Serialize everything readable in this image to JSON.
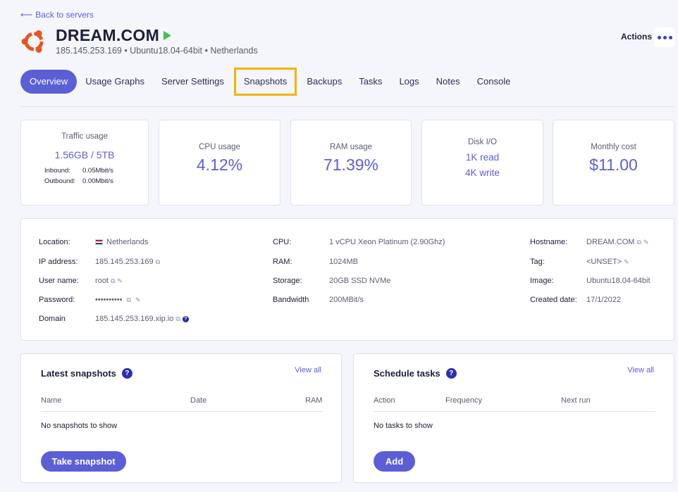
{
  "nav": {
    "back_label": "Back to servers"
  },
  "server": {
    "name": "DREAM.COM",
    "subtitle": "185.145.253.169 • Ubuntu18.04-64bit • Netherlands",
    "status_color": "#44c14b"
  },
  "header": {
    "actions_label": "Actions"
  },
  "tabs": [
    {
      "label": "Overview",
      "active": true
    },
    {
      "label": "Usage Graphs"
    },
    {
      "label": "Server Settings"
    },
    {
      "label": "Snapshots",
      "highlighted": true
    },
    {
      "label": "Backups"
    },
    {
      "label": "Tasks"
    },
    {
      "label": "Logs"
    },
    {
      "label": "Notes"
    },
    {
      "label": "Console"
    }
  ],
  "stats": {
    "traffic": {
      "label": "Traffic usage",
      "value": "1.56GB / 5TB",
      "inbound_label": "Inbound:",
      "inbound_value": "0.05Mbit/s",
      "outbound_label": "Outbound:",
      "outbound_value": "0.00Mbit/s"
    },
    "cpu": {
      "label": "CPU usage",
      "value": "4.12%"
    },
    "ram": {
      "label": "RAM usage",
      "value": "71.39%"
    },
    "disk": {
      "label": "Disk I/O",
      "read": "1K read",
      "write": "4K write"
    },
    "cost": {
      "label": "Monthly cost",
      "value": "$11.00"
    }
  },
  "info": {
    "location_label": "Location:",
    "location": "Netherlands",
    "ip_label": "IP address:",
    "ip": "185.145.253.169",
    "user_label": "User name:",
    "user": "root",
    "password_label": "Password:",
    "password": "••••••••••",
    "domain_label": "Domain",
    "domain": "185.145.253.169.xip.io",
    "cpu_label": "CPU:",
    "cpu": "1 vCPU Xeon Platinum (2.90Ghz)",
    "ram_label": "RAM:",
    "ram": "1024MB",
    "storage_label": "Storage:",
    "storage": "20GB SSD NVMe",
    "bandwidth_label": "Bandwidth",
    "bandwidth": "200MBit/s",
    "hostname_label": "Hostname:",
    "hostname": "DREAM.COM",
    "tag_label": "Tag:",
    "tag": "<UNSET>",
    "image_label": "Image:",
    "image": "Ubuntu18.04-64bit",
    "created_label": "Created date:",
    "created": "17/1/2022"
  },
  "snapshots": {
    "title": "Latest snapshots",
    "view_all": "View all",
    "columns": [
      "Name",
      "Date",
      "RAM"
    ],
    "empty": "No snapshots to show",
    "button": "Take snapshot"
  },
  "tasks": {
    "title": "Schedule tasks",
    "view_all": "View all",
    "columns": [
      "Action",
      "Frequency",
      "Next run"
    ],
    "empty": "No tasks to show",
    "button": "Add"
  }
}
